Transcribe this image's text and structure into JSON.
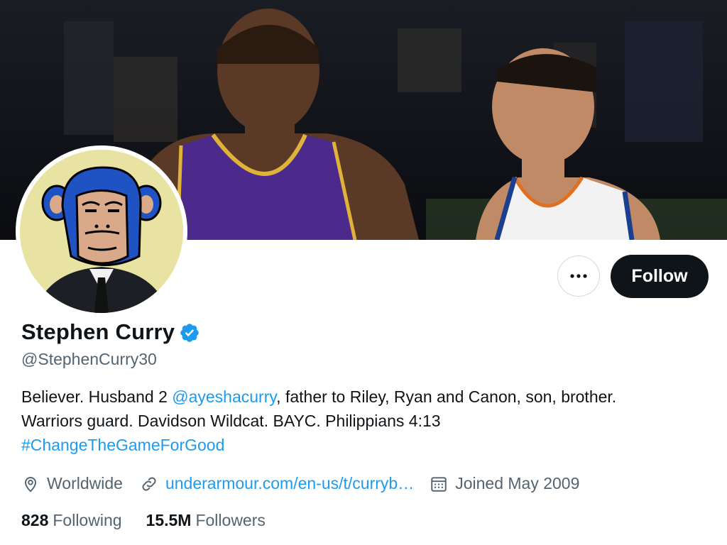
{
  "banner": {
    "description": "header-photo"
  },
  "avatar": {
    "description": "profile-photo"
  },
  "actions": {
    "more_label": "•••",
    "follow_label": "Follow"
  },
  "profile": {
    "display_name": "Stephen Curry",
    "handle": "@StephenCurry30",
    "verified": true,
    "bio": {
      "line1_prefix": "Believer. Husband 2 ",
      "line1_mention": "@ayeshacurry",
      "line1_suffix": ", father to Riley, Ryan and Canon, son, brother.",
      "line2": "Warriors guard. Davidson Wildcat. BAYC. Philippians 4:13",
      "line3_hashtag": "#ChangeTheGameForGood"
    },
    "location": "Worldwide",
    "website": "underarmour.com/en-us/t/curryb…",
    "joined": "Joined May 2009",
    "following_count": "828",
    "following_label": "Following",
    "followers_count": "15.5M",
    "followers_label": "Followers"
  },
  "colors": {
    "link": "#1d9bf0",
    "text": "#0f1419",
    "secondary": "#536471",
    "verified": "#1d9bf0"
  }
}
